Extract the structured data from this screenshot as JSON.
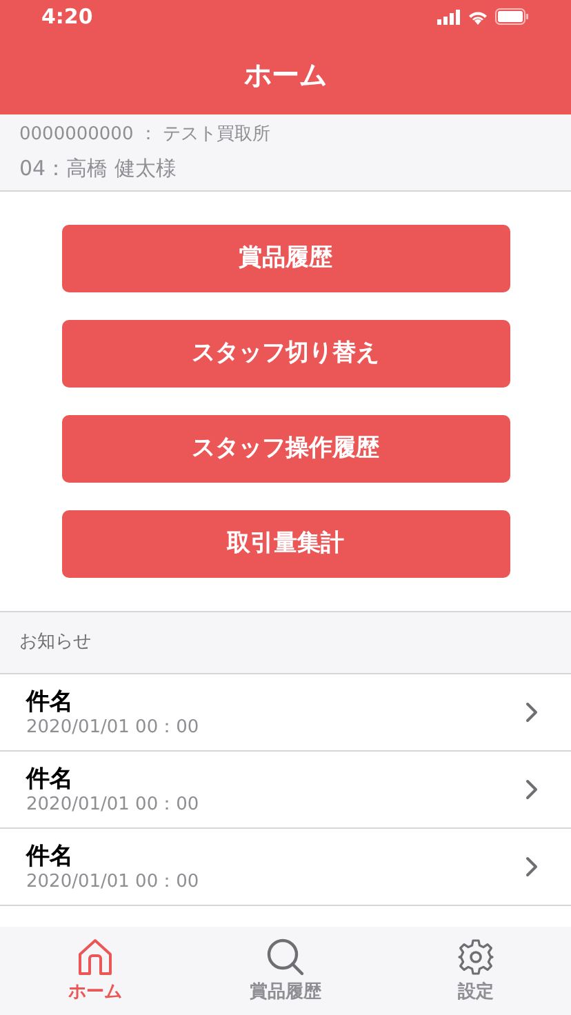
{
  "status_bar": {
    "time": "4:20"
  },
  "header": {
    "title": "ホーム"
  },
  "account": {
    "store": "0000000000 ： テスト買取所",
    "staff": "04：高橋 健太様"
  },
  "buttons": [
    "賞品履歴",
    "スタッフ切り替え",
    "スタッフ操作履歴",
    "取引量集計"
  ],
  "notices": {
    "title": "お知らせ",
    "items": [
      {
        "subject": "件名",
        "date": "2020/01/01 00：00"
      },
      {
        "subject": "件名",
        "date": "2020/01/01 00：00"
      },
      {
        "subject": "件名",
        "date": "2020/01/01 00：00"
      }
    ]
  },
  "tab_bar": [
    {
      "kind": "home",
      "label": "ホーム",
      "selected": true
    },
    {
      "kind": "search",
      "label": "賞品履歴",
      "selected": false
    },
    {
      "kind": "settings",
      "label": "設定",
      "selected": false
    }
  ]
}
